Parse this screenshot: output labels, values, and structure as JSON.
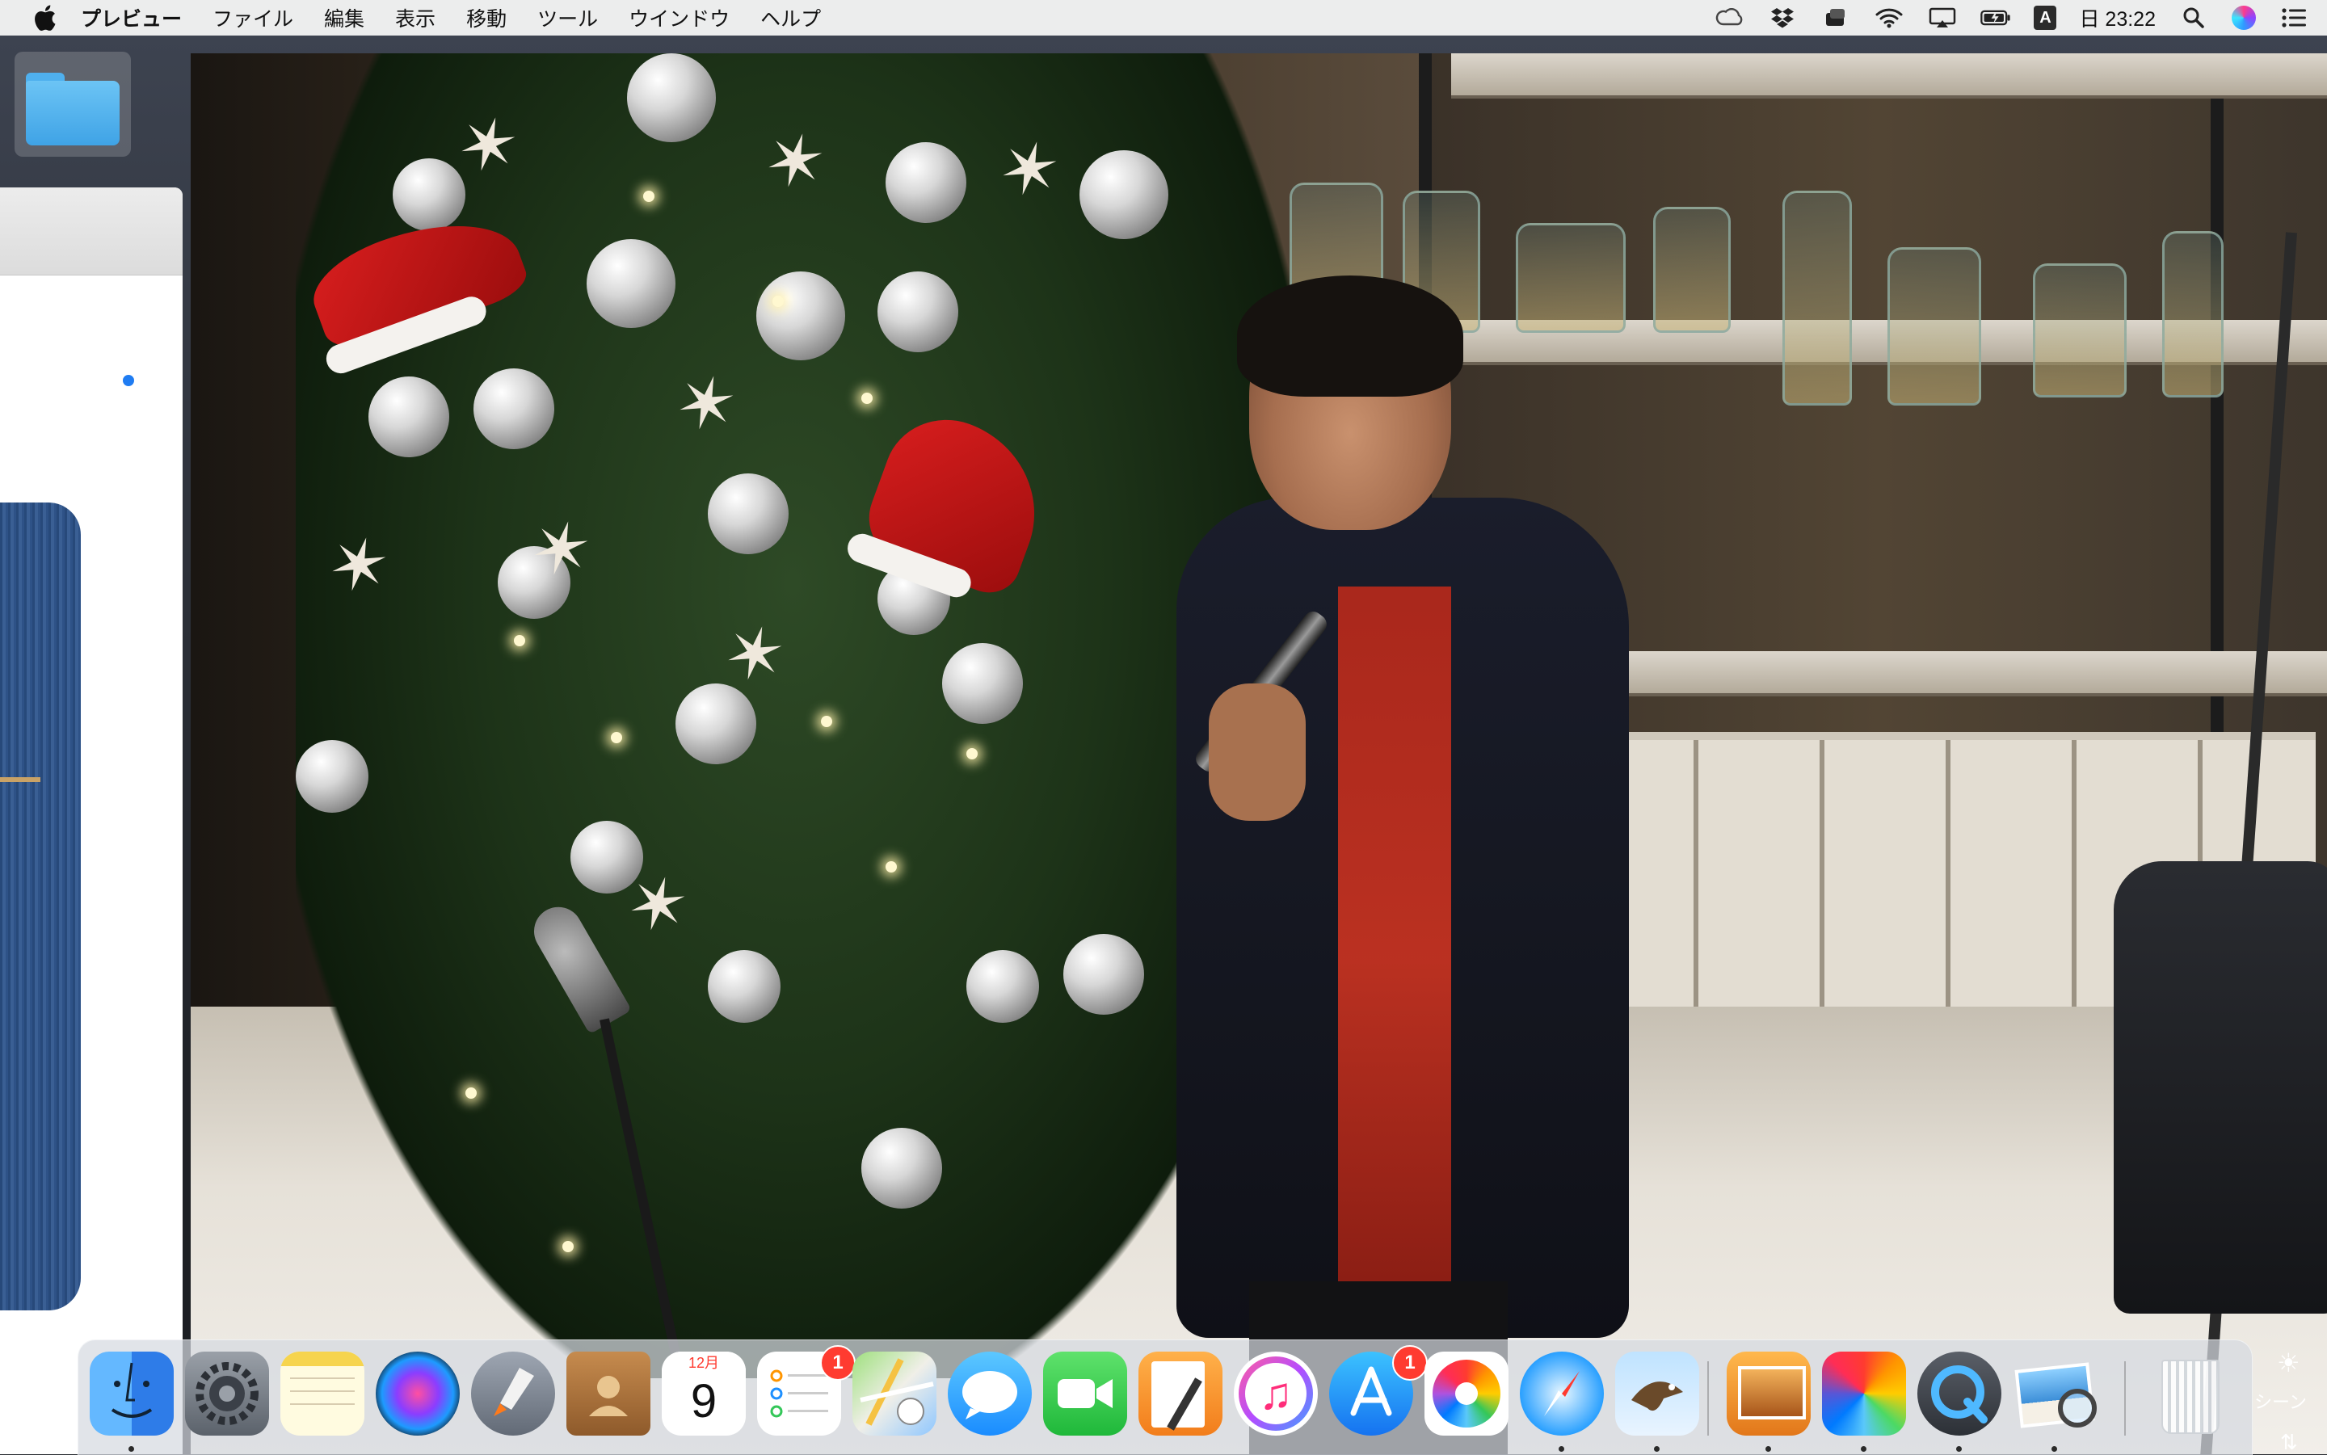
{
  "menubar": {
    "app_name": "プレビュー",
    "items": [
      "ファイル",
      "編集",
      "表示",
      "移動",
      "ツール",
      "ウインドウ",
      "ヘルプ"
    ],
    "ime_indicator": "A",
    "clock": "日 23:22",
    "status_icons": [
      "creative-cloud-icon",
      "dropbox-icon",
      "backup-icon",
      "wifi-icon",
      "airplay-icon",
      "battery-icon",
      "input-source-icon",
      "spotlight-icon",
      "siri-icon",
      "notification-center-icon"
    ]
  },
  "desktop": {
    "folder_icon": "folder-icon"
  },
  "calendar": {
    "month": "12月",
    "day": "9"
  },
  "dock": {
    "apps": [
      {
        "name": "finder",
        "badge": null
      },
      {
        "name": "system-preferences",
        "badge": null
      },
      {
        "name": "notes",
        "badge": null
      },
      {
        "name": "siri",
        "badge": null
      },
      {
        "name": "launchpad",
        "badge": null
      },
      {
        "name": "contacts",
        "badge": null
      },
      {
        "name": "calendar",
        "badge": null
      },
      {
        "name": "reminders",
        "badge": "1"
      },
      {
        "name": "maps",
        "badge": null
      },
      {
        "name": "messages",
        "badge": null
      },
      {
        "name": "facetime",
        "badge": null
      },
      {
        "name": "pages",
        "badge": null
      },
      {
        "name": "itunes",
        "badge": null
      },
      {
        "name": "app-store",
        "badge": "1"
      },
      {
        "name": "photos",
        "badge": null
      },
      {
        "name": "safari",
        "badge": null
      },
      {
        "name": "mail",
        "badge": null
      },
      {
        "name": "keynote",
        "badge": null
      },
      {
        "name": "color-app",
        "badge": null
      },
      {
        "name": "quicktime",
        "badge": null
      },
      {
        "name": "preview",
        "badge": null
      },
      {
        "name": "trash",
        "badge": null
      }
    ]
  },
  "side_panel": {
    "label": "シーン"
  },
  "colors": {
    "menubar_bg": "#eceded",
    "badge_red": "#ff3b30",
    "finder_blue": "#3fa3e6"
  }
}
